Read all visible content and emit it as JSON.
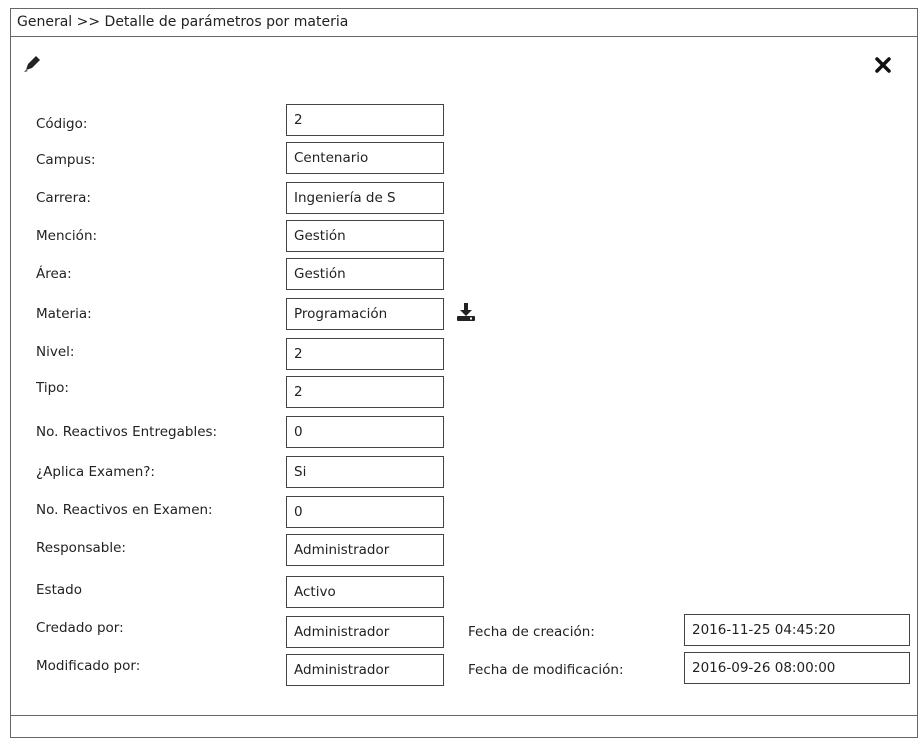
{
  "window": {
    "breadcrumb": "General >> Detalle de parámetros por materia"
  },
  "toolbar": {
    "edit_icon": "pencil-icon",
    "close_icon": "close-icon"
  },
  "form": {
    "codigo": {
      "label": "Código:",
      "value": "2"
    },
    "campus": {
      "label": "Campus:",
      "value": "Centenario"
    },
    "carrera": {
      "label": "Carrera:",
      "value": "Ingeniería de S"
    },
    "mencion": {
      "label": "Mención:",
      "value": "Gestión"
    },
    "area": {
      "label": "Área:",
      "value": "Gestión"
    },
    "materia": {
      "label": "Materia:",
      "value": "Programación",
      "action_icon": "download-icon"
    },
    "nivel": {
      "label": "Nivel:",
      "value": "2"
    },
    "tipo": {
      "label": "Tipo:",
      "value": "2"
    },
    "reactivos_entregables": {
      "label": "No. Reactivos Entregables:",
      "value": "0"
    },
    "aplica_examen": {
      "label": "¿Aplica Examen?:",
      "value": "Si"
    },
    "reactivos_examen": {
      "label": "No. Reactivos en Examen:",
      "value": "0"
    },
    "responsable": {
      "label": "Responsable:",
      "value": "Administrador"
    },
    "estado": {
      "label": "Estado",
      "value": "Activo"
    },
    "creado_por": {
      "label": "Credado por:",
      "value": "Administrador"
    },
    "modificado_por": {
      "label": "Modificado por:",
      "value": "Administrador"
    },
    "fecha_creacion": {
      "label": "Fecha de creación:",
      "value": "2016-11-25 04:45:20"
    },
    "fecha_modificacion": {
      "label": "Fecha de modificación:",
      "value": "2016-09-26 08:00:00"
    }
  }
}
